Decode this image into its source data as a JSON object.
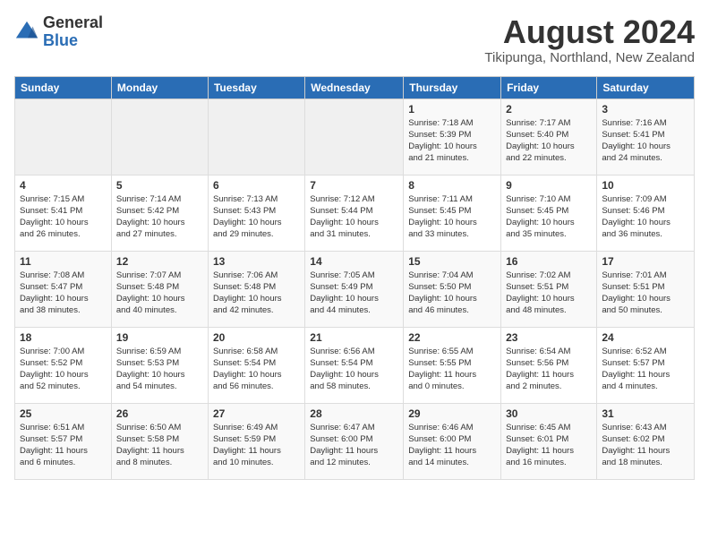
{
  "logo": {
    "general": "General",
    "blue": "Blue"
  },
  "header": {
    "month": "August 2024",
    "location": "Tikipunga, Northland, New Zealand"
  },
  "weekdays": [
    "Sunday",
    "Monday",
    "Tuesday",
    "Wednesday",
    "Thursday",
    "Friday",
    "Saturday"
  ],
  "weeks": [
    [
      {
        "day": "",
        "info": ""
      },
      {
        "day": "",
        "info": ""
      },
      {
        "day": "",
        "info": ""
      },
      {
        "day": "",
        "info": ""
      },
      {
        "day": "1",
        "info": "Sunrise: 7:18 AM\nSunset: 5:39 PM\nDaylight: 10 hours\nand 21 minutes."
      },
      {
        "day": "2",
        "info": "Sunrise: 7:17 AM\nSunset: 5:40 PM\nDaylight: 10 hours\nand 22 minutes."
      },
      {
        "day": "3",
        "info": "Sunrise: 7:16 AM\nSunset: 5:41 PM\nDaylight: 10 hours\nand 24 minutes."
      }
    ],
    [
      {
        "day": "4",
        "info": "Sunrise: 7:15 AM\nSunset: 5:41 PM\nDaylight: 10 hours\nand 26 minutes."
      },
      {
        "day": "5",
        "info": "Sunrise: 7:14 AM\nSunset: 5:42 PM\nDaylight: 10 hours\nand 27 minutes."
      },
      {
        "day": "6",
        "info": "Sunrise: 7:13 AM\nSunset: 5:43 PM\nDaylight: 10 hours\nand 29 minutes."
      },
      {
        "day": "7",
        "info": "Sunrise: 7:12 AM\nSunset: 5:44 PM\nDaylight: 10 hours\nand 31 minutes."
      },
      {
        "day": "8",
        "info": "Sunrise: 7:11 AM\nSunset: 5:45 PM\nDaylight: 10 hours\nand 33 minutes."
      },
      {
        "day": "9",
        "info": "Sunrise: 7:10 AM\nSunset: 5:45 PM\nDaylight: 10 hours\nand 35 minutes."
      },
      {
        "day": "10",
        "info": "Sunrise: 7:09 AM\nSunset: 5:46 PM\nDaylight: 10 hours\nand 36 minutes."
      }
    ],
    [
      {
        "day": "11",
        "info": "Sunrise: 7:08 AM\nSunset: 5:47 PM\nDaylight: 10 hours\nand 38 minutes."
      },
      {
        "day": "12",
        "info": "Sunrise: 7:07 AM\nSunset: 5:48 PM\nDaylight: 10 hours\nand 40 minutes."
      },
      {
        "day": "13",
        "info": "Sunrise: 7:06 AM\nSunset: 5:48 PM\nDaylight: 10 hours\nand 42 minutes."
      },
      {
        "day": "14",
        "info": "Sunrise: 7:05 AM\nSunset: 5:49 PM\nDaylight: 10 hours\nand 44 minutes."
      },
      {
        "day": "15",
        "info": "Sunrise: 7:04 AM\nSunset: 5:50 PM\nDaylight: 10 hours\nand 46 minutes."
      },
      {
        "day": "16",
        "info": "Sunrise: 7:02 AM\nSunset: 5:51 PM\nDaylight: 10 hours\nand 48 minutes."
      },
      {
        "day": "17",
        "info": "Sunrise: 7:01 AM\nSunset: 5:51 PM\nDaylight: 10 hours\nand 50 minutes."
      }
    ],
    [
      {
        "day": "18",
        "info": "Sunrise: 7:00 AM\nSunset: 5:52 PM\nDaylight: 10 hours\nand 52 minutes."
      },
      {
        "day": "19",
        "info": "Sunrise: 6:59 AM\nSunset: 5:53 PM\nDaylight: 10 hours\nand 54 minutes."
      },
      {
        "day": "20",
        "info": "Sunrise: 6:58 AM\nSunset: 5:54 PM\nDaylight: 10 hours\nand 56 minutes."
      },
      {
        "day": "21",
        "info": "Sunrise: 6:56 AM\nSunset: 5:54 PM\nDaylight: 10 hours\nand 58 minutes."
      },
      {
        "day": "22",
        "info": "Sunrise: 6:55 AM\nSunset: 5:55 PM\nDaylight: 11 hours\nand 0 minutes."
      },
      {
        "day": "23",
        "info": "Sunrise: 6:54 AM\nSunset: 5:56 PM\nDaylight: 11 hours\nand 2 minutes."
      },
      {
        "day": "24",
        "info": "Sunrise: 6:52 AM\nSunset: 5:57 PM\nDaylight: 11 hours\nand 4 minutes."
      }
    ],
    [
      {
        "day": "25",
        "info": "Sunrise: 6:51 AM\nSunset: 5:57 PM\nDaylight: 11 hours\nand 6 minutes."
      },
      {
        "day": "26",
        "info": "Sunrise: 6:50 AM\nSunset: 5:58 PM\nDaylight: 11 hours\nand 8 minutes."
      },
      {
        "day": "27",
        "info": "Sunrise: 6:49 AM\nSunset: 5:59 PM\nDaylight: 11 hours\nand 10 minutes."
      },
      {
        "day": "28",
        "info": "Sunrise: 6:47 AM\nSunset: 6:00 PM\nDaylight: 11 hours\nand 12 minutes."
      },
      {
        "day": "29",
        "info": "Sunrise: 6:46 AM\nSunset: 6:00 PM\nDaylight: 11 hours\nand 14 minutes."
      },
      {
        "day": "30",
        "info": "Sunrise: 6:45 AM\nSunset: 6:01 PM\nDaylight: 11 hours\nand 16 minutes."
      },
      {
        "day": "31",
        "info": "Sunrise: 6:43 AM\nSunset: 6:02 PM\nDaylight: 11 hours\nand 18 minutes."
      }
    ]
  ]
}
